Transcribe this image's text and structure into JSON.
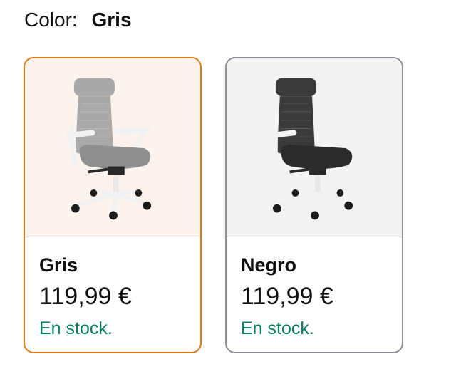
{
  "color_selector": {
    "label": "Color:",
    "selected_value": "Gris"
  },
  "options": [
    {
      "name": "Gris",
      "price": "119,99 €",
      "availability": "En stock.",
      "selected": true,
      "seat_color": "#8f8f8f",
      "back_color": "#a9a9a9",
      "image_background": "#fcf4ec"
    },
    {
      "name": "Negro",
      "price": "119,99 €",
      "availability": "En stock.",
      "selected": false,
      "seat_color": "#2b2b2b",
      "back_color": "#3a3a3a",
      "image_background": "#f3f3f3"
    }
  ],
  "colors": {
    "selected_border": "#e47911",
    "unselected_border": "#8d9096",
    "in_stock_text": "#067d62",
    "text": "#0f1111"
  },
  "icons": {
    "chair_image": "office-chair-icon"
  }
}
